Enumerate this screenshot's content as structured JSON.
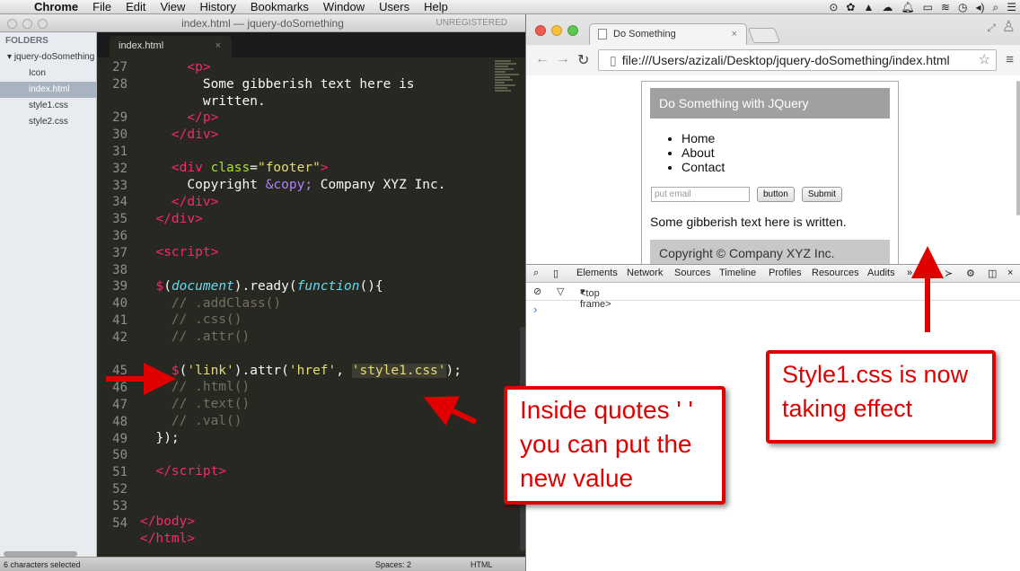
{
  "menubar": {
    "app": "Chrome",
    "items": [
      "File",
      "Edit",
      "View",
      "History",
      "Bookmarks",
      "Window",
      "Users",
      "Help"
    ]
  },
  "sublime": {
    "title": "index.html — jquery-doSomething",
    "unregistered": "UNREGISTERED",
    "sidebar": {
      "header": "FOLDERS",
      "folder": "jquery-doSomething",
      "files": [
        "Icon",
        "index.html",
        "style1.css",
        "style2.css"
      ],
      "selected": "index.html"
    },
    "tab": "index.html",
    "line_numbers": [
      "27",
      "28",
      "",
      "29",
      "30",
      "31",
      "32",
      "33",
      "34",
      "35",
      "36",
      "37",
      "38",
      "39",
      "40",
      "41",
      "42",
      "",
      "45",
      "46",
      "47",
      "48",
      "49",
      "50",
      "51",
      "52",
      "53",
      "54"
    ],
    "status": {
      "selection": "6 characters selected",
      "spaces": "Spaces: 2",
      "syntax": "HTML"
    }
  },
  "chrome": {
    "tab_title": "Do Something",
    "url": "file:///Users/azizali/Desktop/jquery-doSomething/index.html",
    "page": {
      "header": "Do Something with JQuery",
      "nav": [
        "Home",
        "About",
        "Contact"
      ],
      "email_placeholder": "put email",
      "button_label": "button",
      "submit_label": "Submit",
      "text": "Some gibberish text here is written.",
      "footer": "Copyright © Company XYZ Inc."
    },
    "devtools": {
      "tabs": [
        "Elements",
        "Network",
        "Sources",
        "Timeline",
        "Profiles",
        "Resources",
        "Audits"
      ],
      "frame": "<top frame>",
      "prompt": "›"
    }
  },
  "annotations": {
    "callout_quotes": "Inside quotes ' ' you can put the new value",
    "callout_style": "Style1.css is now taking effect",
    "accent": "#e10000"
  }
}
